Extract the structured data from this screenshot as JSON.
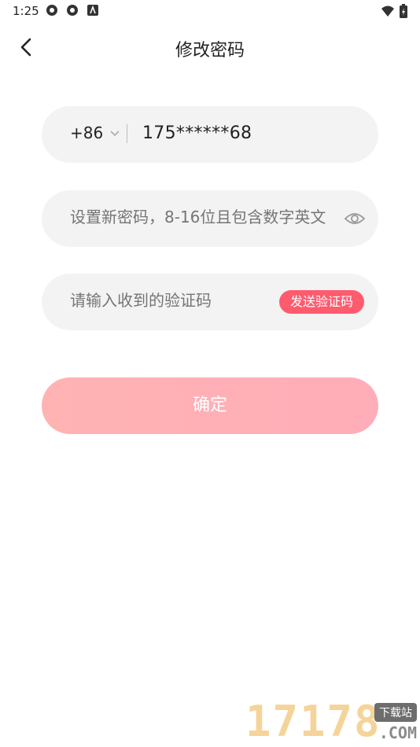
{
  "status_bar": {
    "time": "1:25"
  },
  "header": {
    "title": "修改密码"
  },
  "form": {
    "country_code": "+86",
    "phone": "175******68",
    "password_placeholder": "设置新密码，8-16位且包含数字英文",
    "code_placeholder": "请输入收到的验证码",
    "send_code_label": "发送验证码"
  },
  "confirm_label": "确定",
  "watermark": {
    "digits": "17178",
    "badge": "下载站",
    "suffix": ".COM"
  },
  "colors": {
    "accent": "#ff5b6e",
    "confirm_gradient_start": "#ffb3b2",
    "confirm_gradient_end": "#ffadb9",
    "field_bg": "#f3f3f3"
  },
  "icons": [
    "settings-icon",
    "settings-icon",
    "app-icon",
    "wifi-icon",
    "battery-icon",
    "back-arrow-icon",
    "chevron-down-icon",
    "eye-icon"
  ]
}
